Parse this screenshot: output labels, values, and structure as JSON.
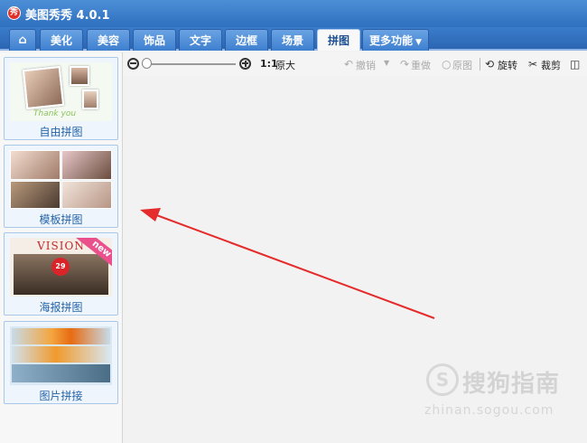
{
  "app": {
    "title": "美图秀秀 4.0.1",
    "logo_text": "秀"
  },
  "tabs": [
    {
      "label": "⌂",
      "icon": "home-icon",
      "active": false
    },
    {
      "label": "美化",
      "active": false
    },
    {
      "label": "美容",
      "active": false
    },
    {
      "label": "饰品",
      "active": false
    },
    {
      "label": "文字",
      "active": false
    },
    {
      "label": "边框",
      "active": false
    },
    {
      "label": "场景",
      "active": false
    },
    {
      "label": "拼图",
      "active": true
    },
    {
      "label": "更多功能",
      "active": false,
      "has_dropdown": true
    }
  ],
  "sidebar": {
    "items": [
      {
        "label": "自由拼图",
        "thumb_text": "Thank you"
      },
      {
        "label": "模板拼图"
      },
      {
        "label": "海报拼图",
        "thumb_text": "VISION",
        "badge": "new",
        "poster_number": "29"
      },
      {
        "label": "图片拼接"
      }
    ]
  },
  "toolbar": {
    "zoom_ratio": "1:1",
    "original_size": "原大",
    "undo": "撤销",
    "redo": "重做",
    "original": "原图",
    "rotate": "旋转",
    "crop": "裁剪"
  },
  "watermark": {
    "logo": "S",
    "text": "搜狗指南",
    "url": "zhinan.sogou.com"
  },
  "colors": {
    "title_bar": "#2f6fbf",
    "tab_active_text": "#1d4f91",
    "card_label": "#2563a8",
    "arrow": "#e52b2b",
    "new_badge": "#e9508c"
  }
}
